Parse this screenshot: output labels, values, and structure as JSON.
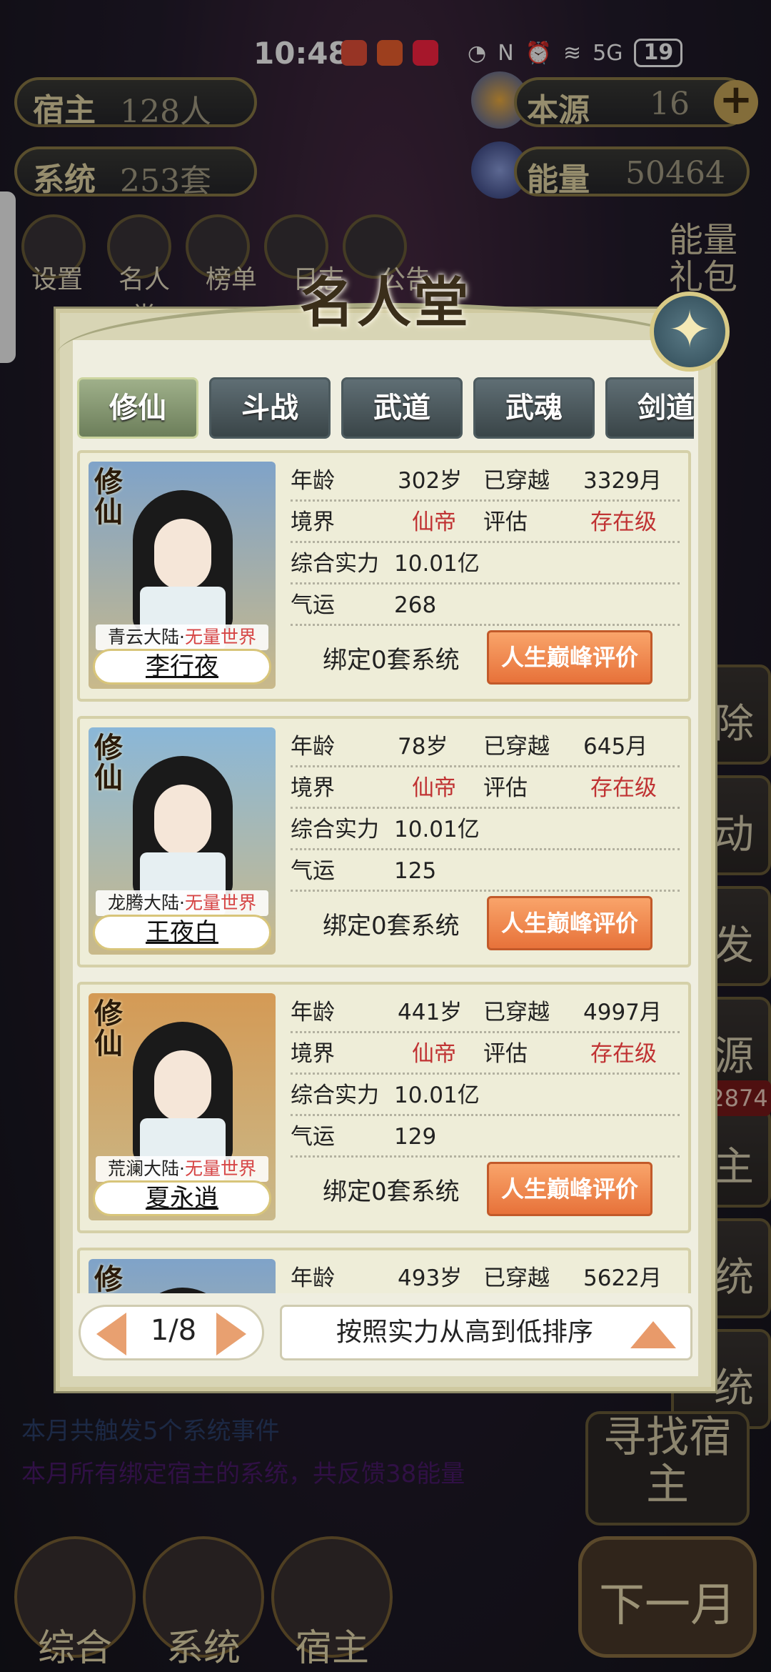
{
  "status_bar": {
    "time": "10:48",
    "battery": "19",
    "network": "5G"
  },
  "top_stats": {
    "host_label": "宿主",
    "host_value": "128人",
    "system_label": "系统",
    "system_value": "253套",
    "origin_label": "本源",
    "origin_value": "16",
    "energy_label": "能量",
    "energy_value": "50464"
  },
  "menu": [
    "设置",
    "名人堂",
    "榜单",
    "日志",
    "公告"
  ],
  "energy_gift": "能量礼包",
  "right_buttons": [
    "除",
    "动",
    "发",
    "源",
    "主",
    "统",
    "统"
  ],
  "right_badge": "2874",
  "log_lines": [
    "本月共触发5个系统事件",
    "本月所有绑定宿主的系统，共反馈38能量"
  ],
  "find_host": "寻找宿主",
  "bottom_nav": [
    "综合",
    "系统",
    "宿主"
  ],
  "next_month": "下一月",
  "modal": {
    "title": "名人堂",
    "close_icon": "compass-close-icon",
    "tabs": [
      "修仙",
      "斗战",
      "武道",
      "武魂",
      "剑道"
    ],
    "active_tab": 0,
    "field_labels": {
      "age": "年龄",
      "traveled": "已穿越",
      "realm": "境界",
      "rating": "评估",
      "power": "综合实力",
      "luck": "气运"
    },
    "peak_button": "人生巅峰评价",
    "cards": [
      {
        "tag": "修仙",
        "region": "青云大陆·",
        "world": "无量世界",
        "name": "李行夜",
        "age": "302岁",
        "traveled": "3329月",
        "realm": "仙帝",
        "rating": "存在级",
        "power": "10.01亿",
        "luck": "268",
        "bind": "绑定0套系统",
        "sky": "#7fa3c9"
      },
      {
        "tag": "修仙",
        "region": "龙腾大陆·",
        "world": "无量世界",
        "name": "王夜白",
        "age": "78岁",
        "traveled": "645月",
        "realm": "仙帝",
        "rating": "存在级",
        "power": "10.01亿",
        "luck": "125",
        "bind": "绑定0套系统",
        "sky": "#8ab7d8"
      },
      {
        "tag": "修仙",
        "region": "荒澜大陆·",
        "world": "无量世界",
        "name": "夏永逍",
        "age": "441岁",
        "traveled": "4997月",
        "realm": "仙帝",
        "rating": "存在级",
        "power": "10.01亿",
        "luck": "129",
        "bind": "绑定0套系统",
        "sky": "#d49a55"
      },
      {
        "tag": "修仙",
        "region": "",
        "world": "",
        "name": "",
        "age": "493岁",
        "traveled": "5622月",
        "realm": "",
        "rating": "",
        "power": "",
        "luck": "",
        "bind": "",
        "sky": "#7fa3c9"
      }
    ],
    "page_indicator": "1/8",
    "sort_label": "按照实力从高到低排序"
  }
}
